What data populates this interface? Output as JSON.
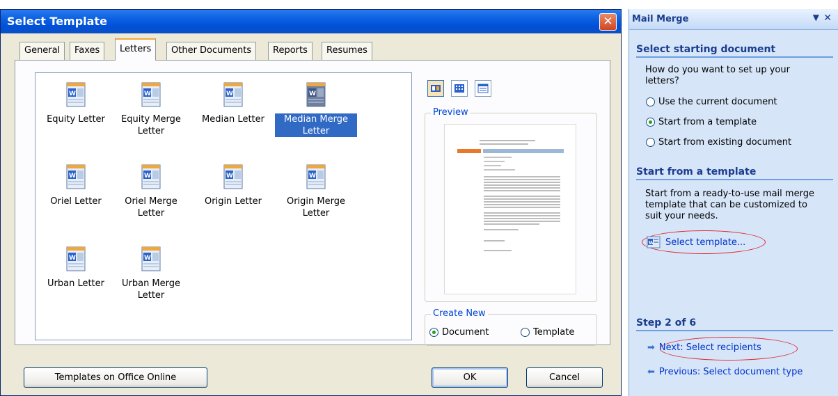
{
  "dialog": {
    "title": "Select Template",
    "close_glyph": "✕",
    "tabs": [
      "General",
      "Faxes",
      "Letters",
      "Other Documents",
      "Reports",
      "Resumes"
    ],
    "active_tab": "Letters",
    "templates": [
      {
        "label": "Equity Letter"
      },
      {
        "label": "Equity Merge Letter"
      },
      {
        "label": "Median Letter"
      },
      {
        "label": "Median Merge Letter",
        "selected": true
      },
      {
        "label": "Oriel Letter"
      },
      {
        "label": "Oriel Merge Letter"
      },
      {
        "label": "Origin Letter"
      },
      {
        "label": "Origin Merge Letter"
      },
      {
        "label": "Urban Letter"
      },
      {
        "label": "Urban Merge Letter"
      }
    ],
    "preview_label": "Preview",
    "create_new": {
      "label": "Create New",
      "options": [
        "Document",
        "Template"
      ],
      "selected": "Document"
    },
    "buttons": {
      "templates_online": "Templates on Office Online",
      "ok": "OK",
      "cancel": "Cancel"
    },
    "icons": [
      "word-template-icon",
      "large-icons-view-icon",
      "list-view-icon",
      "details-view-icon"
    ]
  },
  "task_pane": {
    "title": "Mail Merge",
    "menu_glyph": "▼",
    "close_glyph": "✕",
    "section1": {
      "heading": "Select starting document",
      "question": "How do you want to set up your letters?",
      "options": [
        "Use the current document",
        "Start from a template",
        "Start from existing document"
      ],
      "selected": "Start from a template"
    },
    "section2": {
      "heading": "Start from a template",
      "description": "Start from a ready-to-use mail merge template that can be customized to suit your needs.",
      "link": "Select template..."
    },
    "step": {
      "heading": "Step 2 of 6",
      "next": "Next: Select recipients",
      "previous": "Previous: Select document type"
    },
    "colors": {
      "accent": "#1a3d8f",
      "link": "#0033cc",
      "annotation": "#e0262f"
    }
  }
}
